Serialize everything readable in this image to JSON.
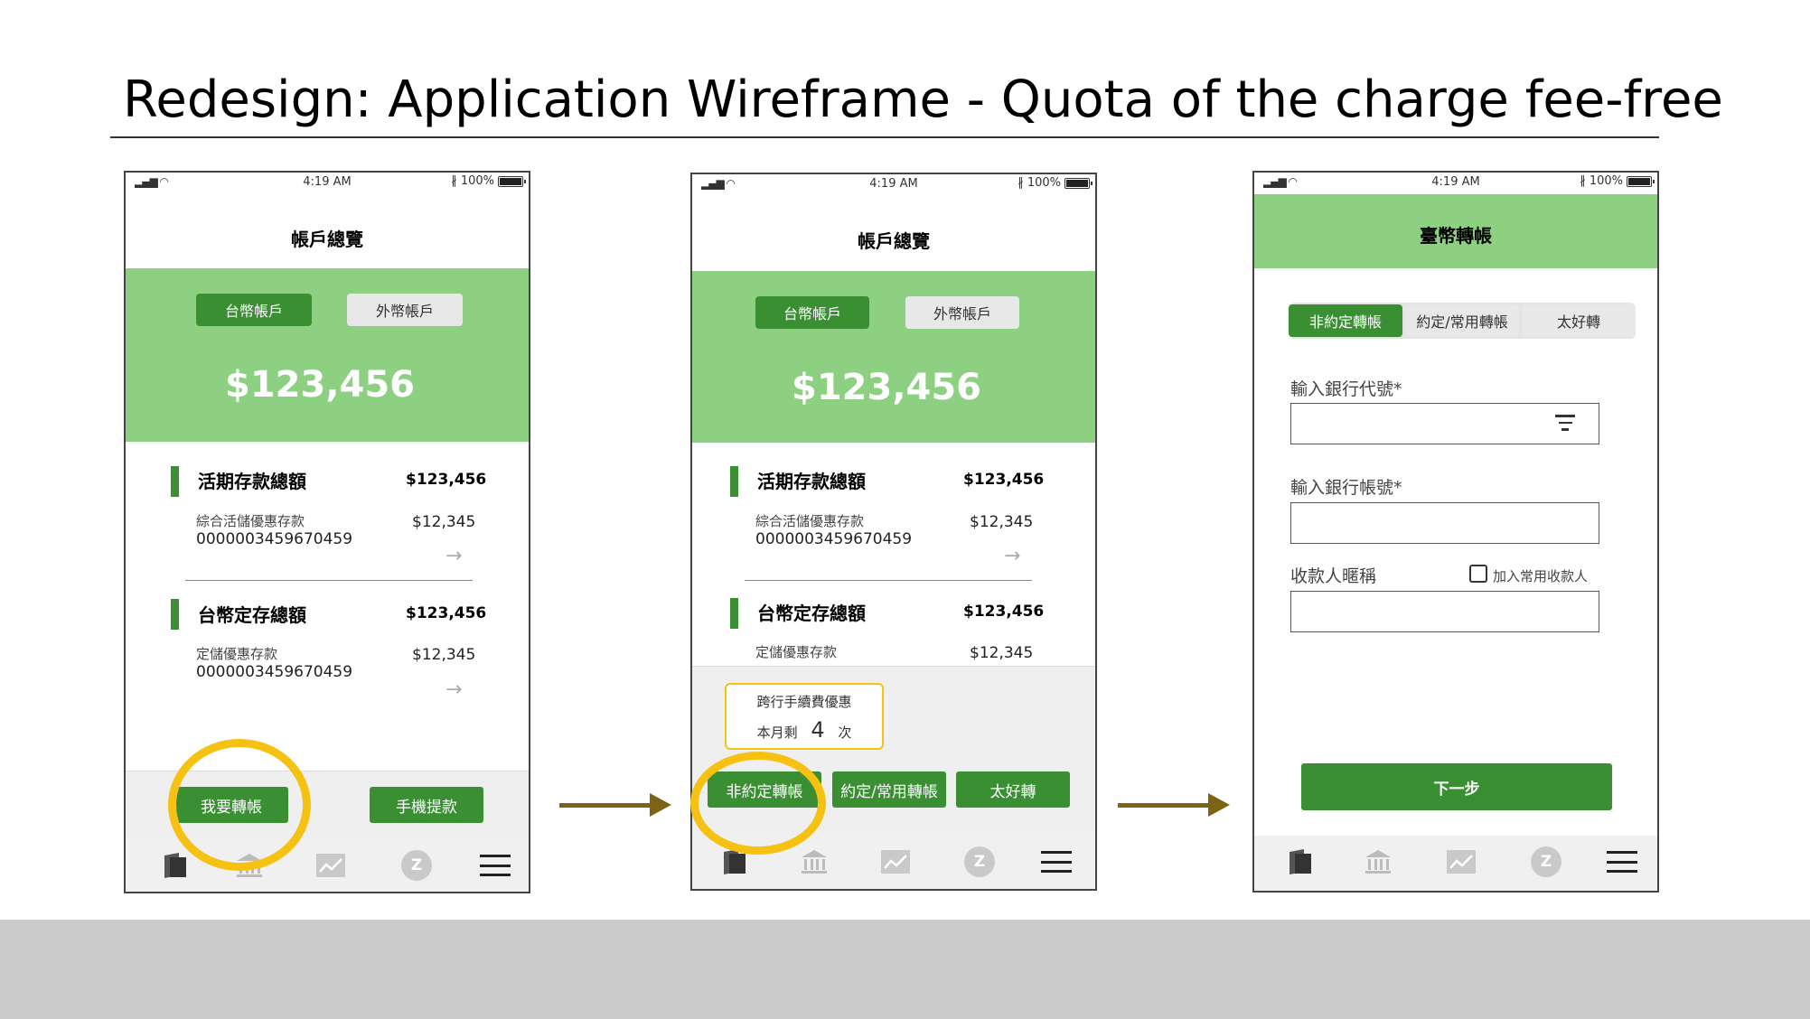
{
  "slide": {
    "title": "Redesign: Application Wireframe - Quota of the charge fee-free"
  },
  "status": {
    "time": "4:19 AM",
    "battery": "100%",
    "bluetooth": "∦"
  },
  "screen1": {
    "header": "帳戶總覽",
    "tabs": [
      "台幣帳戶",
      "外幣帳戶"
    ],
    "balance": "$123,456",
    "sections": [
      {
        "title": "活期存款總額",
        "total": "$123,456",
        "account_name": "綜合活儲優惠存款",
        "account_no": "0000003459670459",
        "amount": "$12,345"
      },
      {
        "title": "台幣定存總額",
        "total": "$123,456",
        "account_name": "定儲優惠存款",
        "account_no": "0000003459670459",
        "amount": "$12,345"
      }
    ],
    "actions": [
      "我要轉帳",
      "手機提款"
    ]
  },
  "screen2": {
    "header": "帳戶總覽",
    "tabs": [
      "台幣帳戶",
      "外幣帳戶"
    ],
    "balance": "$123,456",
    "sections": [
      {
        "title": "活期存款總額",
        "total": "$123,456",
        "account_name": "綜合活儲優惠存款",
        "account_no": "0000003459670459",
        "amount": "$12,345"
      },
      {
        "title": "台幣定存總額",
        "total": "$123,456",
        "account_name": "定儲優惠存款",
        "amount": "$12,345"
      }
    ],
    "quota": {
      "title": "跨行手續費優惠",
      "prefix": "本月剩",
      "count": "4",
      "suffix": "次"
    },
    "actions": [
      "非約定轉帳",
      "約定/常用轉帳",
      "太好轉"
    ]
  },
  "screen3": {
    "header": "臺幣轉帳",
    "tabs": [
      "非約定轉帳",
      "約定/常用轉帳",
      "太好轉"
    ],
    "fields": {
      "bank_code_label": "輸入銀行代號*",
      "account_label": "輸入銀行帳號*",
      "nickname_label": "收款人暱稱",
      "add_payee_label": "加入常用收款人"
    },
    "next": "下一步"
  },
  "colors": {
    "brand_green": "#3a8f33",
    "panel_green": "#8ed082",
    "highlight": "#f5c213",
    "arrow": "#7c6414"
  },
  "icons": [
    "wallet-icon",
    "bank-icon",
    "chart-icon",
    "z-icon",
    "menu-icon"
  ]
}
